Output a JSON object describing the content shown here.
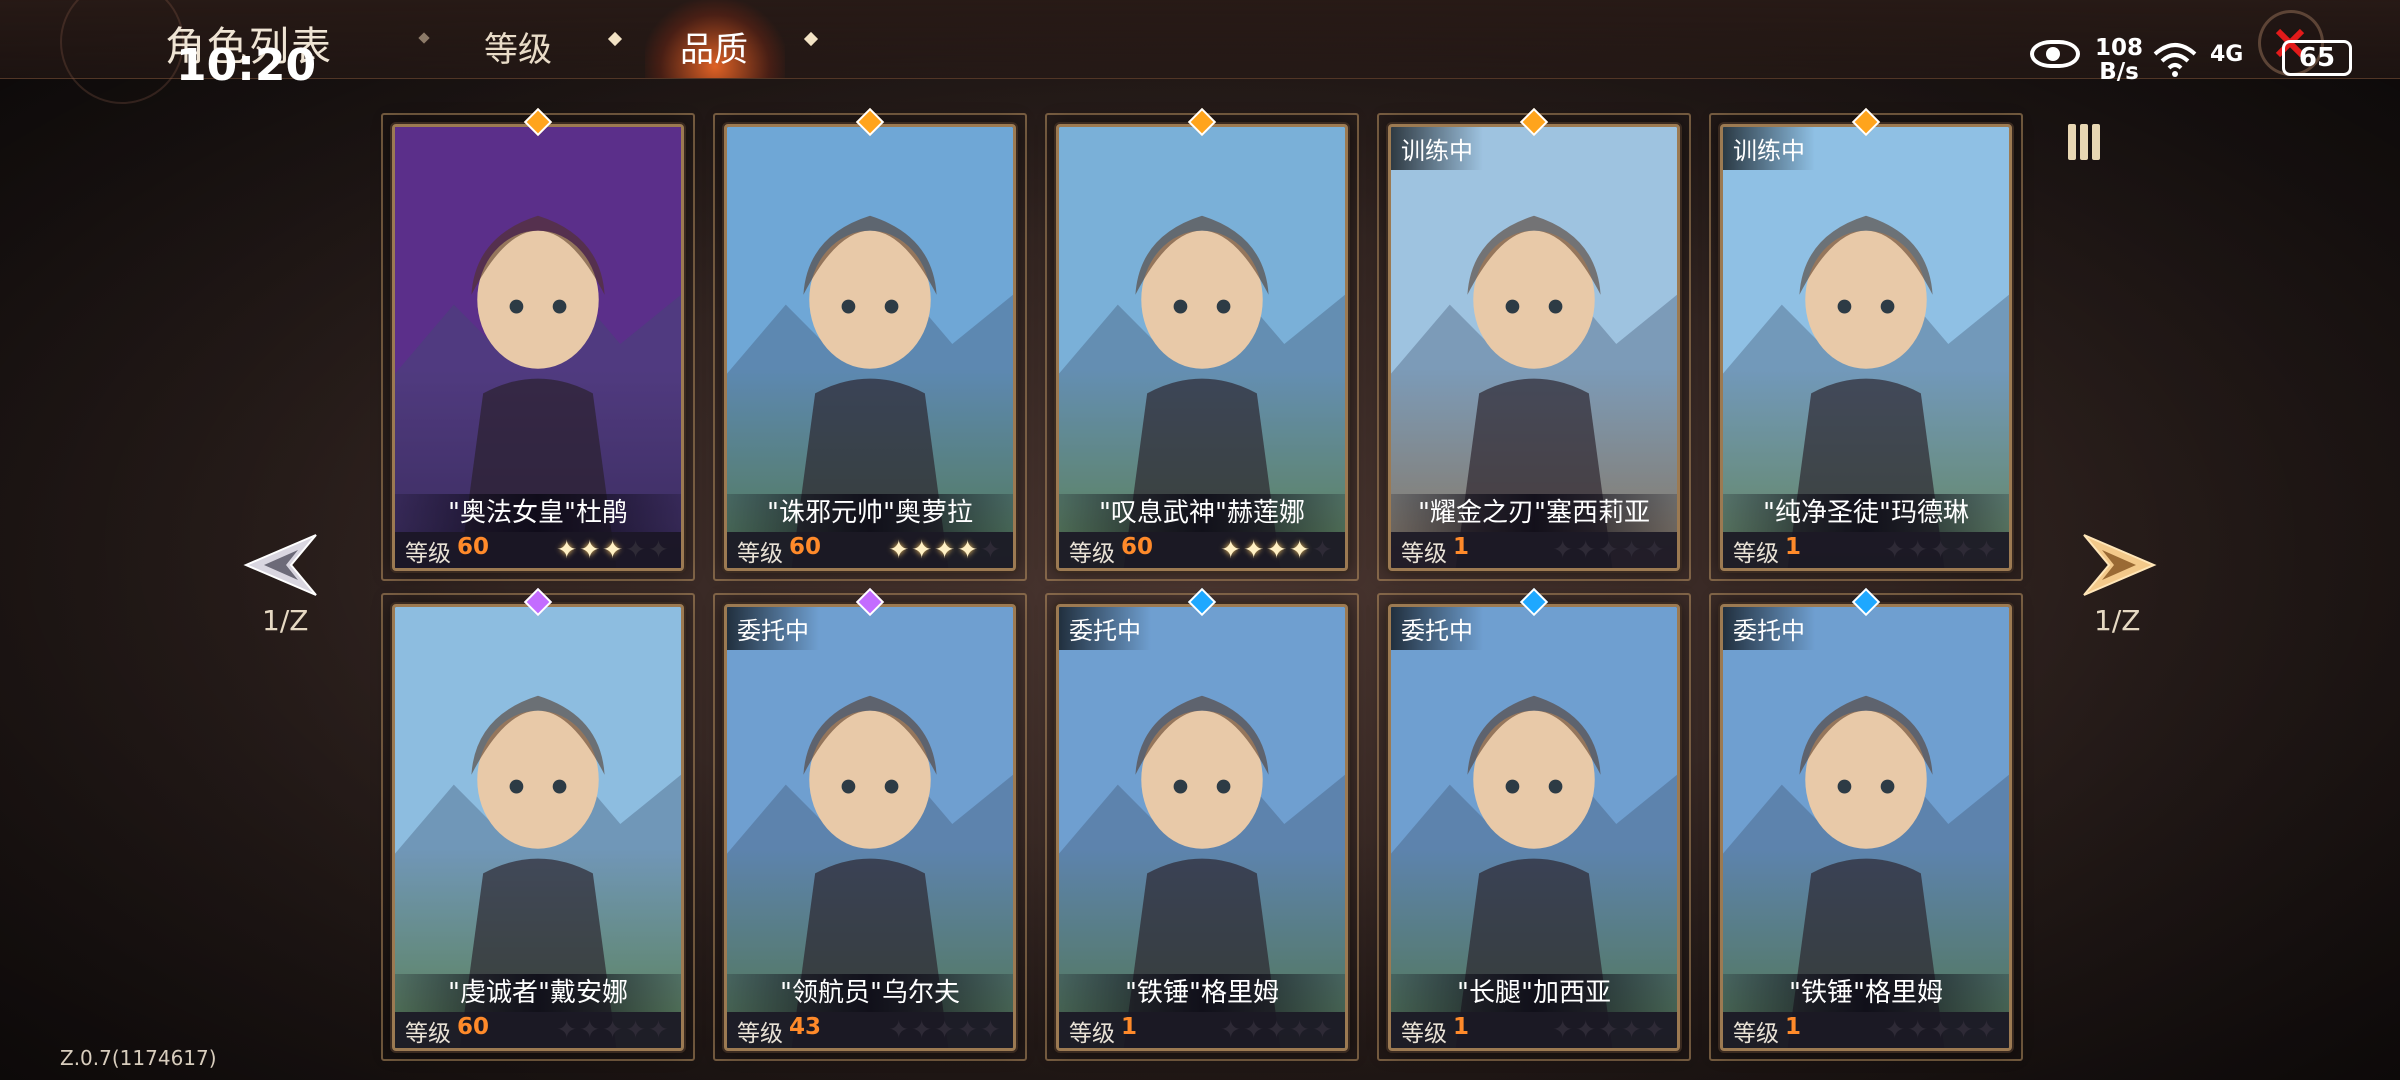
{
  "header": {
    "title": "角色列表",
    "clock": "10:20",
    "tabs": [
      {
        "label": "等级",
        "active": false
      },
      {
        "label": "品质",
        "active": true
      }
    ]
  },
  "status_bar": {
    "net_speed_value": "108",
    "net_speed_unit": "B/s",
    "network": "4G",
    "battery": "65"
  },
  "pagination": {
    "left": "1/Z",
    "right": "1/Z"
  },
  "colors": {
    "gem_orange": "#ffa41c",
    "gem_purple": "#c36cff",
    "gem_blue": "#1ea8ff",
    "level_accent": "#ff8a2a"
  },
  "characters": [
    {
      "name": "\"奥法女皇\"杜鹃",
      "level_label": "等级",
      "level": "60",
      "stars": 3,
      "status": "",
      "gem": "gem_orange",
      "palette": [
        "#5b2f8a",
        "#3a1a55"
      ]
    },
    {
      "name": "\"诛邪元帅\"奥萝拉",
      "level_label": "等级",
      "level": "60",
      "stars": 4,
      "status": "",
      "gem": "gem_orange",
      "palette": [
        "#6fa7d6",
        "#5f8f46"
      ]
    },
    {
      "name": "\"叹息武神\"赫莲娜",
      "level_label": "等级",
      "level": "60",
      "stars": 4,
      "status": "",
      "gem": "gem_orange",
      "palette": [
        "#7ab0d8",
        "#6c9a44"
      ]
    },
    {
      "name": "\"耀金之刃\"塞西莉亚",
      "level_label": "等级",
      "level": "1",
      "stars": 0,
      "status": "训练中",
      "gem": "gem_orange",
      "palette": [
        "#9ec3e0",
        "#b08a5a"
      ]
    },
    {
      "name": "\"纯净圣徒\"玛德琳",
      "level_label": "等级",
      "level": "1",
      "stars": 0,
      "status": "训练中",
      "gem": "gem_orange",
      "palette": [
        "#8fc0e4",
        "#78a255"
      ]
    },
    {
      "name": "\"虔诚者\"戴安娜",
      "level_label": "等级",
      "level": "60",
      "stars": 0,
      "status": "",
      "gem": "gem_purple",
      "palette": [
        "#8dbde0",
        "#6a9a45"
      ]
    },
    {
      "name": "\"领航员\"乌尔夫",
      "level_label": "等级",
      "level": "43",
      "stars": 0,
      "status": "委托中",
      "gem": "gem_purple",
      "palette": [
        "#6f9fd0",
        "#5e8a40"
      ]
    },
    {
      "name": "\"铁锤\"格里姆",
      "level_label": "等级",
      "level": "1",
      "stars": 0,
      "status": "委托中",
      "gem": "gem_blue",
      "palette": [
        "#6f9fd0",
        "#5e8a40"
      ]
    },
    {
      "name": "\"长腿\"加西亚",
      "level_label": "等级",
      "level": "1",
      "stars": 0,
      "status": "委托中",
      "gem": "gem_blue",
      "palette": [
        "#6f9fd0",
        "#5e8a40"
      ]
    },
    {
      "name": "\"铁锤\"格里姆",
      "level_label": "等级",
      "level": "1",
      "stars": 0,
      "status": "委托中",
      "gem": "gem_blue",
      "palette": [
        "#6f9fd0",
        "#5e8a40"
      ]
    }
  ],
  "version": "Z.0.7(1174617)"
}
